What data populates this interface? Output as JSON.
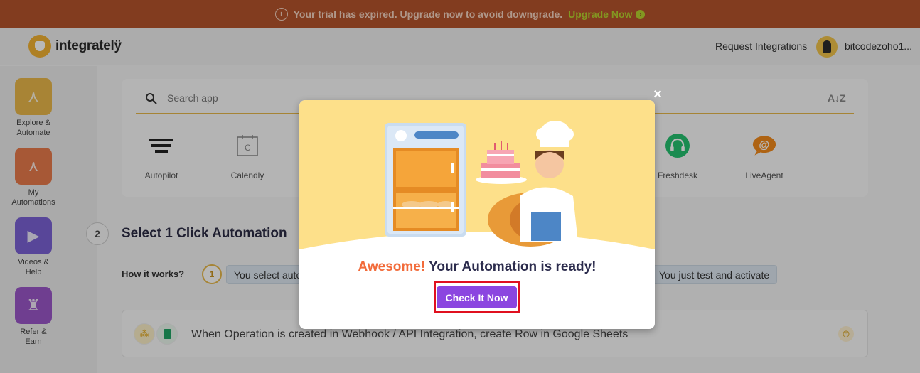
{
  "banner": {
    "info_icon": "info-icon",
    "message": "Your trial has expired. Upgrade now to avoid downgrade.",
    "upgrade_label": "Upgrade Now"
  },
  "header": {
    "logo_text": "integratelÿ",
    "request_label": "Request Integrations",
    "username": "bitcodezoho1..."
  },
  "sidebar": {
    "items": [
      {
        "label_line1": "Explore &",
        "label_line2": "Automate",
        "color": "#e9b84a",
        "icon": "explore-icon"
      },
      {
        "label_line1": "My",
        "label_line2": "Automations",
        "color": "#e87a4c",
        "icon": "automations-icon"
      },
      {
        "label_line1": "Videos &",
        "label_line2": "Help",
        "color": "#7a62d4",
        "icon": "play-icon"
      },
      {
        "label_line1": "Refer &",
        "label_line2": "Earn",
        "color": "#9a57c8",
        "icon": "trophy-icon"
      }
    ]
  },
  "search": {
    "placeholder": "Search app",
    "sort_label": "A↓Z"
  },
  "apps": [
    {
      "name": "Autopilot"
    },
    {
      "name": "Calendly"
    },
    {
      "name": "Freshdesk"
    },
    {
      "name": "LiveAgent"
    }
  ],
  "step": {
    "number": "2",
    "title": "Select 1 Click Automation",
    "how_label": "How it works?",
    "how_number": "1",
    "pill_left": "You select auto",
    "pill_right": "You just test and activate"
  },
  "automation": {
    "text": "When Operation is created in Webhook / API Integration, create Row in Google Sheets"
  },
  "modal": {
    "highlight": "Awesome!",
    "title": " Your Automation is ready!",
    "cta_label": "Check It Now",
    "close_label": "×"
  },
  "colors": {
    "banner_bg": "#b5542b",
    "upgrade": "#b6d12f",
    "accent_gold": "#e6b84a",
    "cta_purple": "#8b46e0",
    "highlight_orange": "#f26b3a"
  }
}
